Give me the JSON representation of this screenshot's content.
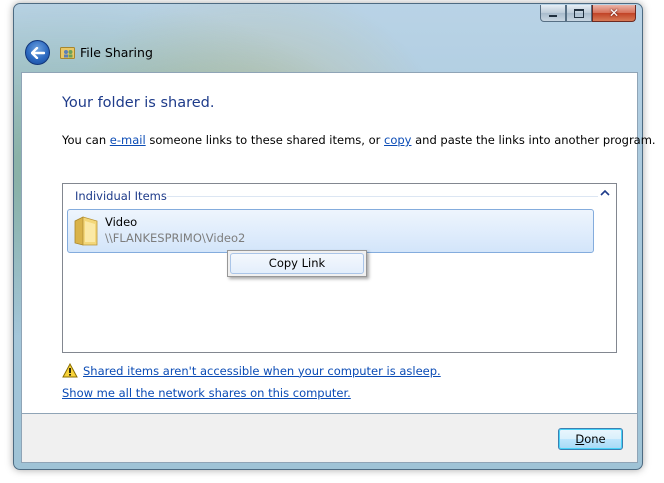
{
  "window": {
    "title": "File Sharing",
    "caption_buttons": [
      "minimize",
      "maximize",
      "close"
    ]
  },
  "main": {
    "heading": "Your folder is shared.",
    "description": {
      "prefix": "You can ",
      "email_link": "e-mail",
      "middle": " someone links to these shared items, or ",
      "copy_link": "copy",
      "suffix": " and paste the links into another program."
    },
    "list": {
      "group_label": "Individual Items",
      "items": [
        {
          "name": "Video",
          "path": "\\\\FLANKESPRIMO\\Video2"
        }
      ]
    },
    "context_menu": {
      "items": [
        "Copy Link"
      ]
    },
    "warning_link": "Shared items aren't accessible when your computer is asleep.",
    "show_shares_link": "Show me all the network shares on this computer."
  },
  "footer": {
    "done_label_underlined": "D",
    "done_label_rest": "one"
  },
  "colors": {
    "heading": "#1e3b8a",
    "link": "#0a4bb5",
    "selection": "#d3e5fa"
  }
}
